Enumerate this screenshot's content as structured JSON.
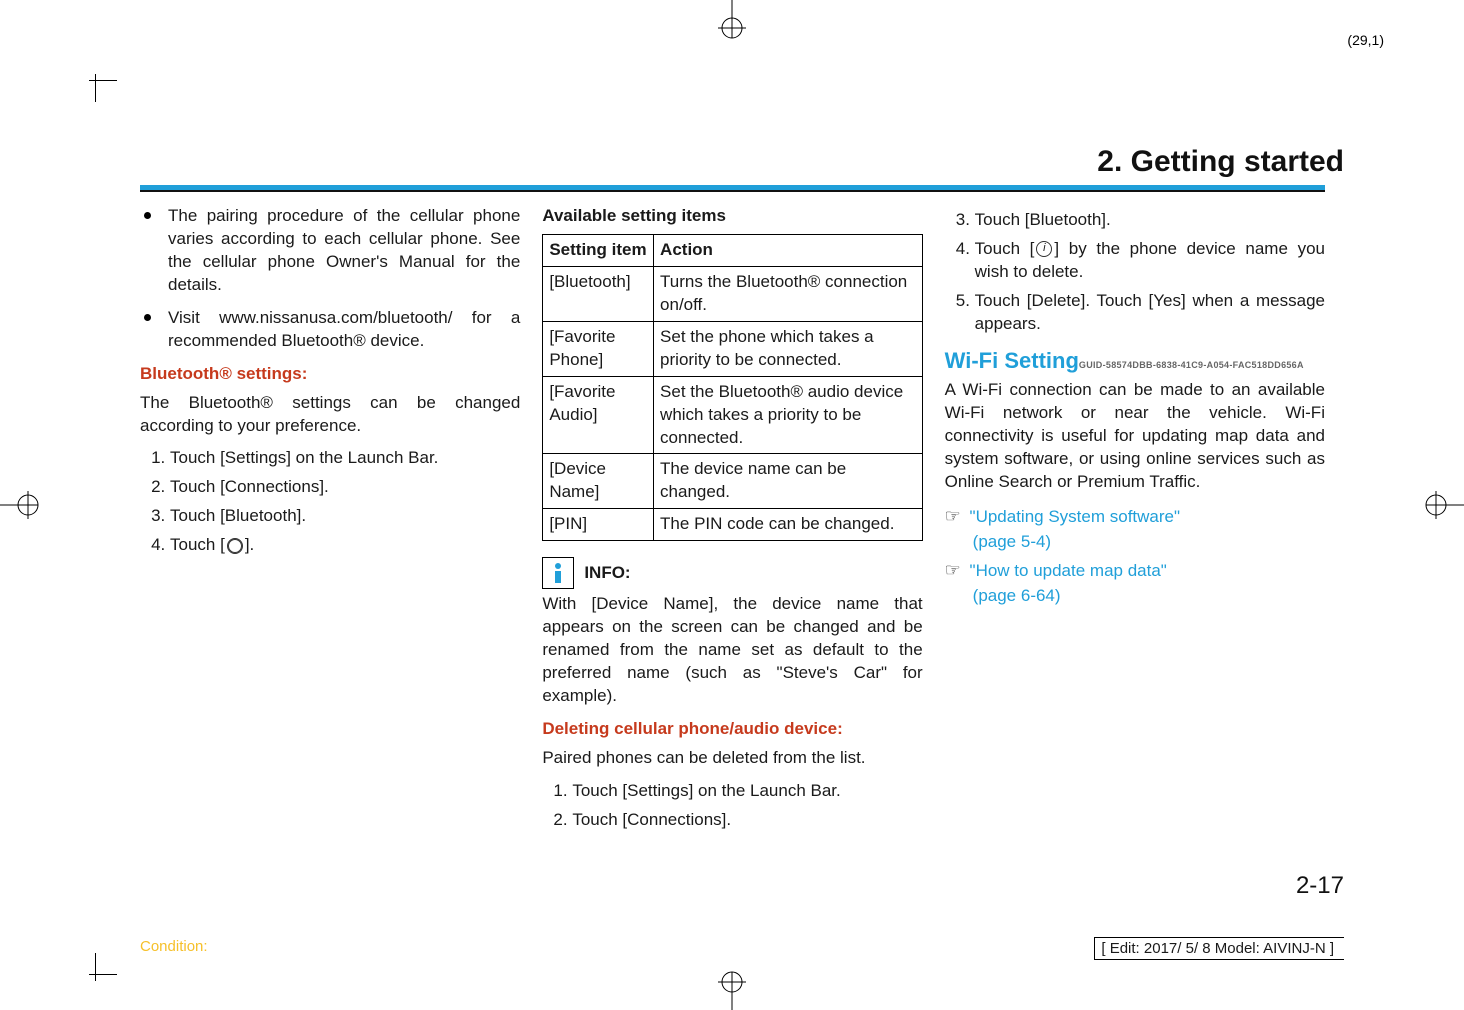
{
  "sheet_label": "(29,1)",
  "chapter_title": "2. Getting started",
  "col1": {
    "bullets": [
      "The pairing procedure of the cellular phone varies according to each cellular phone. See the cellular phone Owner's Manual for the details.",
      "Visit www.nissanusa.com/bluetooth/ for a recommended Bluetooth® device."
    ],
    "bt_settings_head": "Bluetooth® settings:",
    "bt_settings_intro": "The Bluetooth® settings can be changed according to your preference.",
    "steps": [
      "Touch [Settings] on the Launch Bar.",
      "Touch [Connections].",
      "Touch [Bluetooth].",
      "Touch [⚙]."
    ]
  },
  "col2": {
    "table_caption": "Available setting items",
    "headers": [
      "Setting item",
      "Action"
    ],
    "rows": [
      [
        "[Bluetooth]",
        "Turns the Bluetooth® connection on/off."
      ],
      [
        "[Favorite Phone]",
        "Set the phone which takes a priority to be connected."
      ],
      [
        "[Favorite Audio]",
        "Set the Bluetooth® audio device which takes a priority to be connected."
      ],
      [
        "[Device Name]",
        "The device name can be changed."
      ],
      [
        "[PIN]",
        "The PIN code can be changed."
      ]
    ],
    "info_label": "INFO:",
    "info_text": "With [Device Name], the device name that appears on the screen can be changed and be renamed from the name set as default to the preferred name (such as \"Steve's Car\" for example).",
    "delete_head": "Deleting cellular phone/audio device:",
    "delete_intro": "Paired phones can be deleted from the list.",
    "delete_steps": [
      "Touch [Settings] on the Launch Bar.",
      "Touch [Connections]."
    ]
  },
  "col3": {
    "steps_cont": [
      "Touch [Bluetooth].",
      "Touch [ⓘ] by the phone device name you wish to delete.",
      "Touch [Delete]. Touch [Yes] when a message appears."
    ],
    "wifi_head": "Wi-Fi Setting",
    "guid": "GUID-58574DBB-6838-41C9-A054-FAC518DD656A",
    "wifi_text": "A Wi-Fi connection can be made to an available Wi-Fi network or near the vehicle. Wi-Fi connectivity is useful for updating map data and system software, or using online services such as Online Search or Premium Traffic.",
    "refs": [
      {
        "title": "\"Updating System software\"",
        "page": "(page 5-4)"
      },
      {
        "title": "\"How to update map data\"",
        "page": "(page 6-64)"
      }
    ]
  },
  "page_number": "2-17",
  "condition_label": "Condition:",
  "edit_line": "[ Edit: 2017/ 5/ 8    Model:  AIVINJ-N ]"
}
